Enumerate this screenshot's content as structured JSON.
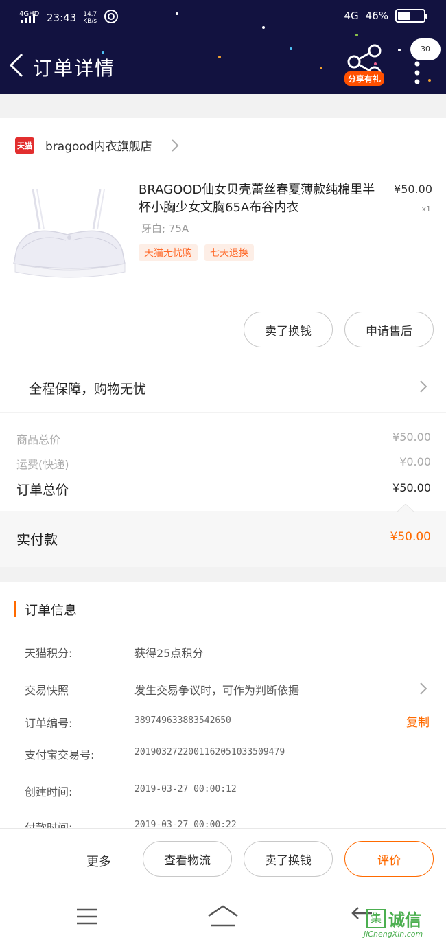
{
  "status_bar": {
    "network_left": "4GHD",
    "time": "23:43",
    "speed_value": "14.7",
    "speed_unit": "KB/s",
    "network_right": "4G",
    "battery": "46%"
  },
  "header": {
    "title": "订单详情",
    "share_label": "分享有礼",
    "bubble_count": "30"
  },
  "shop": {
    "badge": "天猫",
    "name": "bragood内衣旗舰店"
  },
  "product": {
    "title": "BRAGOOD仙女贝壳蕾丝春夏薄款纯棉里半杯小胸少女文胸65A布谷内衣",
    "price": "¥50.00",
    "quantity": "x1",
    "sku": "牙白; 75A",
    "tags": [
      "天猫无忧购",
      "七天退换"
    ],
    "buttons": [
      "卖了换钱",
      "申请售后"
    ]
  },
  "guarantee": "全程保障，购物无忧",
  "pricing": {
    "goods_total_label": "商品总价",
    "goods_total": "¥50.00",
    "shipping_label": "运费(快递)",
    "shipping": "¥0.00",
    "order_total_label": "订单总价",
    "order_total": "¥50.00",
    "paid_label": "实付款",
    "paid": "¥50.00"
  },
  "order_info": {
    "title": "订单信息",
    "rows": [
      {
        "key": "天猫积分:",
        "value": "获得25点积分"
      },
      {
        "key": "交易快照",
        "value": "发生交易争议时，可作为判断依据"
      },
      {
        "key": "订单编号:",
        "value": "389749633883542650"
      },
      {
        "key": "支付宝交易号:",
        "value": "2019032722001162051033509479"
      },
      {
        "key": "创建时间:",
        "value": "2019-03-27 00:00:12"
      },
      {
        "key": "付款时间:",
        "value": "2019-03-27 00:00:22"
      }
    ],
    "copy_label": "复制"
  },
  "action_bar": {
    "more": "更多",
    "view_logistics": "查看物流",
    "sell": "卖了换钱",
    "review": "评价"
  },
  "watermark": {
    "box": "集",
    "text": "诚信",
    "url": "JiChengXin.com"
  },
  "colors": {
    "header_bg": "#121240",
    "accent": "#ff6a00",
    "tmall_red": "#e22e2e"
  }
}
